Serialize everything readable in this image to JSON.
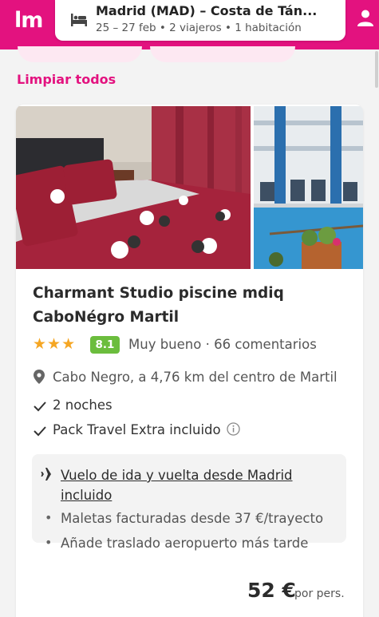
{
  "header": {
    "logo": "lm",
    "search_title": "Madrid (MAD) – Costa de Tán...",
    "search_subtitle": "25 – 27 feb • 2 viajeros • 1 habitación",
    "brand_color": "#e3127f"
  },
  "filters": {
    "clear_all_label": "Limpiar todos"
  },
  "listing": {
    "name": "Charmant Studio piscine mdiq CaboNégro Martil",
    "stars": 3,
    "rating": "8.1",
    "rating_text": "Muy bueno · 66 comentarios",
    "location": "Cabo Negro, a 4,76 km del centro de Martil",
    "features": [
      "2 noches",
      "Pack Travel Extra incluido"
    ],
    "flight": {
      "link_text": "Vuelo de ida y vuelta desde Madrid incluido",
      "notes": [
        "Maletas facturadas desde 37 €/trayecto",
        "Añade traslado aeropuerto más tarde"
      ]
    },
    "price": "52 €",
    "price_unit": "por pers."
  },
  "icons": [
    "bed-icon",
    "user-icon",
    "star-icon",
    "location-pin-icon",
    "check-icon",
    "info-icon",
    "plane-icon"
  ]
}
